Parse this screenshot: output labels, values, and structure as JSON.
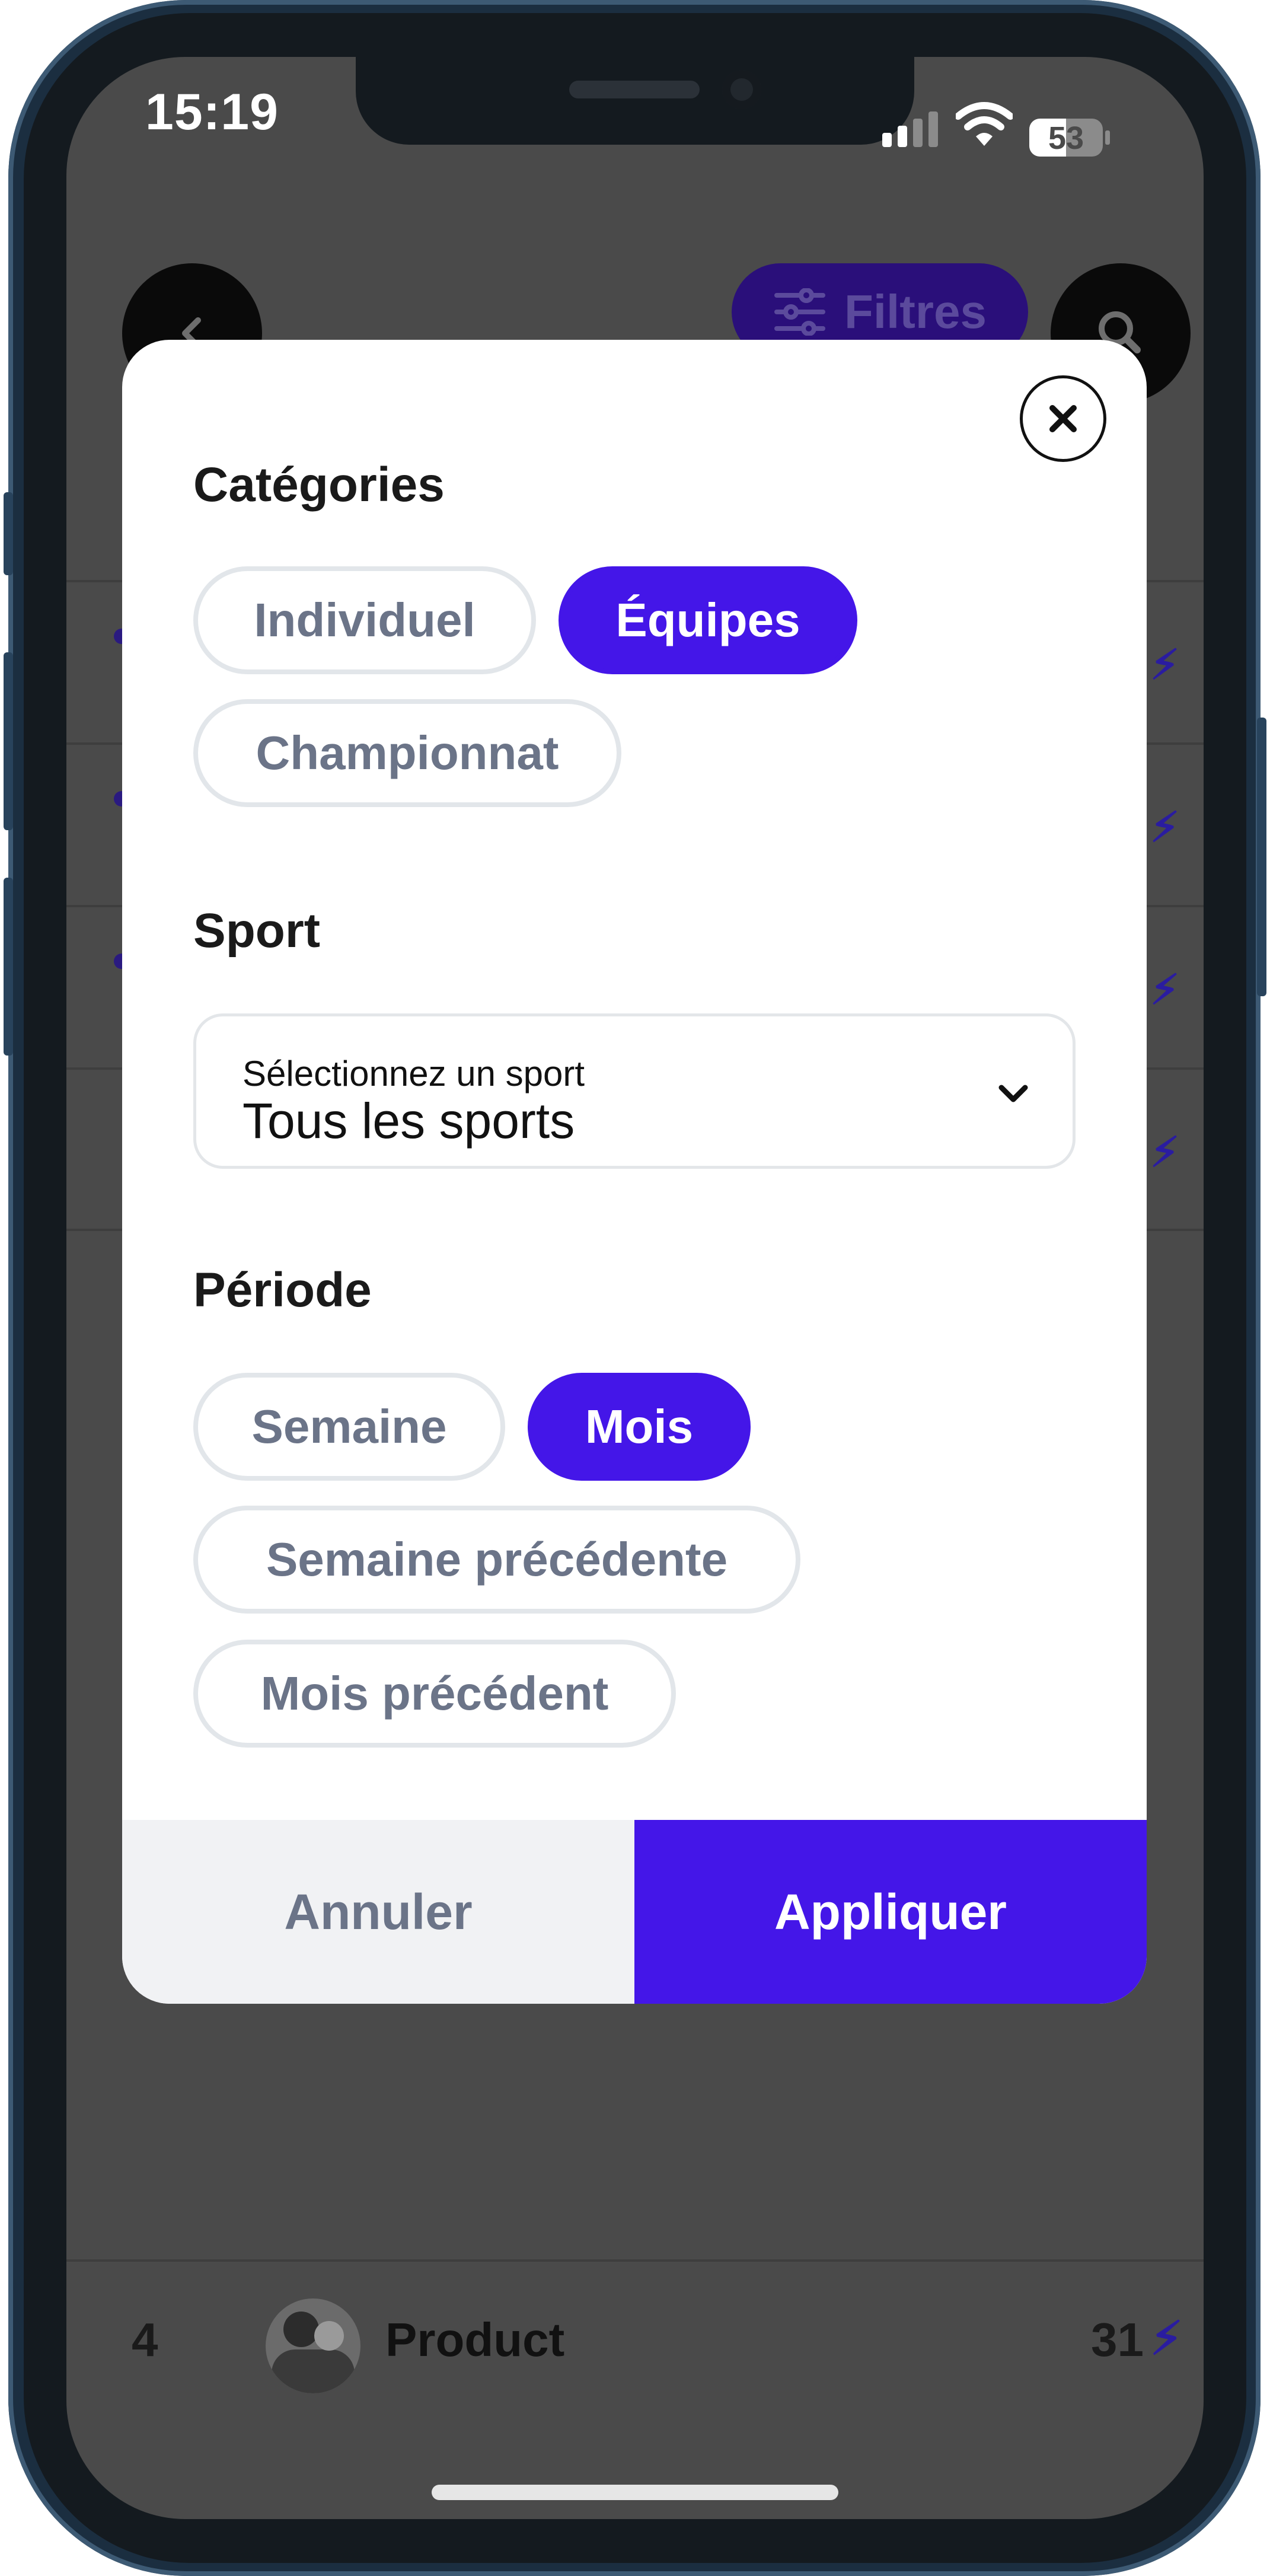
{
  "status_bar": {
    "time": "15:19",
    "battery_level": "53",
    "signal_icon": "cellular-signal-icon",
    "wifi_icon": "wifi-icon"
  },
  "background_page": {
    "filter_button_label": "Filtres",
    "bottom_row": {
      "rank": "4",
      "name": "Product",
      "score": "31"
    }
  },
  "modal": {
    "categories": {
      "title": "Catégories",
      "options": [
        {
          "label": "Individuel",
          "selected": false
        },
        {
          "label": "Équipes",
          "selected": true
        },
        {
          "label": "Championnat",
          "selected": false
        }
      ]
    },
    "sport": {
      "title": "Sport",
      "select_label": "Sélectionnez un sport",
      "select_value": "Tous les sports"
    },
    "period": {
      "title": "Période",
      "options": [
        {
          "label": "Semaine",
          "selected": false
        },
        {
          "label": "Mois",
          "selected": true
        },
        {
          "label": "Semaine précédente",
          "selected": false
        },
        {
          "label": "Mois précédent",
          "selected": false
        }
      ]
    },
    "footer": {
      "cancel_label": "Annuler",
      "apply_label": "Appliquer"
    }
  },
  "colors": {
    "accent": "#4416e8",
    "chip_text": "#6b7488",
    "chip_border": "#e2e6ea",
    "overlay": "#4a4a4a"
  }
}
